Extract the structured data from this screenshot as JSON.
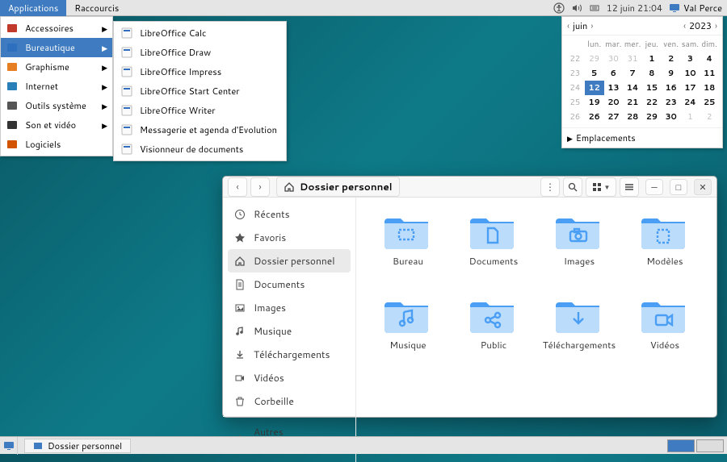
{
  "topbar": {
    "applications": "Applications",
    "shortcuts": "Raccourcis",
    "datetime": "12 juin 21:04",
    "username": "Val Perce"
  },
  "menu1": {
    "items": [
      {
        "label": "Accessoires",
        "hasSubmenu": true
      },
      {
        "label": "Bureautique",
        "active": true,
        "hasSubmenu": true
      },
      {
        "label": "Graphisme",
        "hasSubmenu": true
      },
      {
        "label": "Internet",
        "hasSubmenu": true
      },
      {
        "label": "Outils système",
        "hasSubmenu": true
      },
      {
        "label": "Son et vidéo",
        "hasSubmenu": true
      },
      {
        "label": "Logiciels",
        "hasSubmenu": false
      }
    ]
  },
  "menu2": {
    "items": [
      "LibreOffice Calc",
      "LibreOffice Draw",
      "LibreOffice Impress",
      "LibreOffice Start Center",
      "LibreOffice Writer",
      "Messagerie et agenda d'Evolution",
      "Visionneur de documents"
    ]
  },
  "calendar": {
    "month": "juin",
    "year": "2023",
    "dayHeaders": [
      "lun.",
      "mar.",
      "mer.",
      "jeu.",
      "ven.",
      "sam.",
      "dim."
    ],
    "weekNums": [
      "22",
      "23",
      "24",
      "25",
      "26"
    ],
    "grid": [
      [
        29,
        30,
        31,
        1,
        2,
        3,
        4
      ],
      [
        5,
        6,
        7,
        8,
        9,
        10,
        11
      ],
      [
        12,
        13,
        14,
        15,
        16,
        17,
        18
      ],
      [
        19,
        20,
        21,
        22,
        23,
        24,
        25
      ],
      [
        26,
        27,
        28,
        29,
        30,
        1,
        2
      ]
    ],
    "today": 12,
    "prevMonthDays": [
      29,
      30,
      31
    ],
    "nextMonthDays": [
      1,
      2
    ],
    "locations": "Emplacements"
  },
  "fileManager": {
    "location": "Dossier personnel",
    "sidebar": [
      {
        "icon": "clock",
        "label": "Récents"
      },
      {
        "icon": "star",
        "label": "Favoris"
      },
      {
        "icon": "home",
        "label": "Dossier personnel",
        "active": true
      },
      {
        "icon": "doc",
        "label": "Documents"
      },
      {
        "icon": "image",
        "label": "Images"
      },
      {
        "icon": "music",
        "label": "Musique"
      },
      {
        "icon": "download",
        "label": "Téléchargements"
      },
      {
        "icon": "video",
        "label": "Vidéos"
      },
      {
        "icon": "trash",
        "label": "Corbeille"
      },
      {
        "separator": true
      },
      {
        "icon": "plus",
        "label": "Autres emplacements"
      }
    ],
    "folders": [
      {
        "label": "Bureau",
        "glyph": "desktop"
      },
      {
        "label": "Documents",
        "glyph": "doc"
      },
      {
        "label": "Images",
        "glyph": "camera"
      },
      {
        "label": "Modèles",
        "glyph": "template"
      },
      {
        "label": "Musique",
        "glyph": "music"
      },
      {
        "label": "Public",
        "glyph": "share"
      },
      {
        "label": "Téléchargements",
        "glyph": "download"
      },
      {
        "label": "Vidéos",
        "glyph": "video"
      }
    ]
  },
  "taskbar": {
    "windowTitle": "Dossier personnel"
  }
}
